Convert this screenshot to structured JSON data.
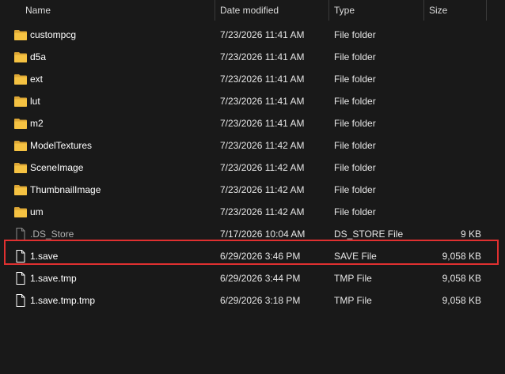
{
  "columns": {
    "name": "Name",
    "date_modified": "Date modified",
    "type": "Type",
    "size": "Size",
    "sort_indicator": "^"
  },
  "colors": {
    "background": "#191919",
    "folder_icon": "#f0c040",
    "file_icon": "#ffffff",
    "highlight": "#e03030"
  },
  "files": [
    {
      "name": "custompcg",
      "date": "7/23/2026 11:41 AM",
      "type": "File folder",
      "size": "",
      "icon": "folder-icon"
    },
    {
      "name": "d5a",
      "date": "7/23/2026 11:41 AM",
      "type": "File folder",
      "size": "",
      "icon": "folder-icon"
    },
    {
      "name": "ext",
      "date": "7/23/2026 11:41 AM",
      "type": "File folder",
      "size": "",
      "icon": "folder-icon"
    },
    {
      "name": "lut",
      "date": "7/23/2026 11:41 AM",
      "type": "File folder",
      "size": "",
      "icon": "folder-icon"
    },
    {
      "name": "m2",
      "date": "7/23/2026 11:41 AM",
      "type": "File folder",
      "size": "",
      "icon": "folder-icon"
    },
    {
      "name": "ModelTextures",
      "date": "7/23/2026 11:42 AM",
      "type": "File folder",
      "size": "",
      "icon": "folder-icon"
    },
    {
      "name": "SceneImage",
      "date": "7/23/2026 11:42 AM",
      "type": "File folder",
      "size": "",
      "icon": "folder-icon"
    },
    {
      "name": "ThumbnailImage",
      "date": "7/23/2026 11:42 AM",
      "type": "File folder",
      "size": "",
      "icon": "folder-icon"
    },
    {
      "name": "um",
      "date": "7/23/2026 11:42 AM",
      "type": "File folder",
      "size": "",
      "icon": "folder-icon"
    },
    {
      "name": ".DS_Store",
      "date": "7/17/2026 10:04 AM",
      "type": "DS_STORE File",
      "size": "9 KB",
      "icon": "hidden-file-icon"
    },
    {
      "name": "1.save",
      "date": "6/29/2026 3:46 PM",
      "type": "SAVE File",
      "size": "9,058 KB",
      "icon": "file-icon",
      "highlighted": true
    },
    {
      "name": "1.save.tmp",
      "date": "6/29/2026 3:44 PM",
      "type": "TMP File",
      "size": "9,058 KB",
      "icon": "file-icon"
    },
    {
      "name": "1.save.tmp.tmp",
      "date": "6/29/2026 3:18 PM",
      "type": "TMP File",
      "size": "9,058 KB",
      "icon": "file-icon"
    }
  ]
}
